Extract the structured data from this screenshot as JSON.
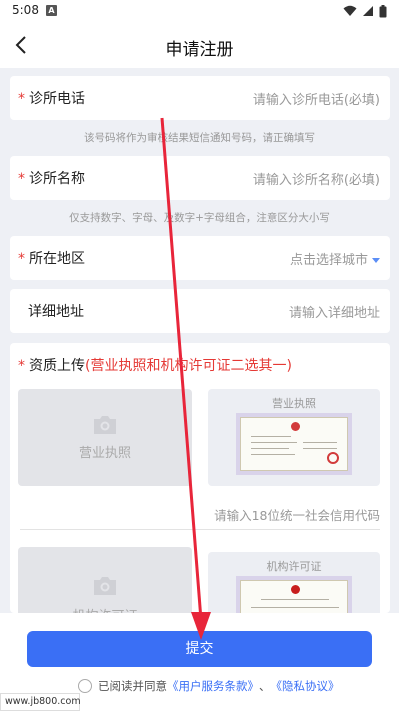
{
  "status_bar": {
    "time": "5:08",
    "notice_letter": "A"
  },
  "header": {
    "title": "申请注册"
  },
  "form": {
    "required_mark": "*",
    "phone": {
      "label": "诊所电话",
      "placeholder": "请输入诊所电话(必填)",
      "hint": "该号码将作为审核结果短信通知号码，请正确填写"
    },
    "name": {
      "label": "诊所名称",
      "placeholder": "请输入诊所名称(必填)",
      "hint": "仅支持数字、字母、及数字+字母组合，注意区分大小写"
    },
    "region": {
      "label": "所在地区",
      "placeholder": "点击选择城市"
    },
    "address": {
      "label": "详细地址",
      "placeholder": "请输入详细地址"
    }
  },
  "qualification": {
    "label": "资质上传",
    "note": "(营业执照和机构许可证二选其一)",
    "business_license": {
      "upload_label": "营业执照",
      "sample_title": "营业执照",
      "credit_code_placeholder": "请输入18位统一社会信用代码"
    },
    "institution_permit": {
      "upload_label": "机构许可证",
      "sample_title": "机构许可证"
    }
  },
  "footer": {
    "submit_label": "提交",
    "agree_prefix": "已阅读并同意",
    "terms_link": "《用户服务条款》",
    "separator": "、",
    "privacy_link": "《隐私协议》"
  },
  "watermark": "www.jb800.com",
  "colors": {
    "accent": "#3a6ff5",
    "required": "#e53935",
    "annotation_arrow": "#e8253a"
  }
}
